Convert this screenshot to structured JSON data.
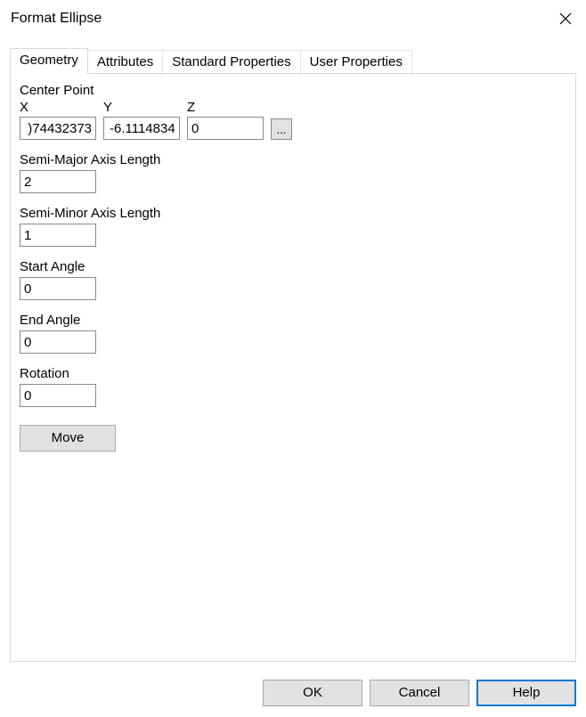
{
  "window": {
    "title": "Format Ellipse"
  },
  "tabs": {
    "geometry": "Geometry",
    "attributes": "Attributes",
    "standard_properties": "Standard Properties",
    "user_properties": "User Properties",
    "active": "geometry"
  },
  "geometry": {
    "center_point_label": "Center Point",
    "x_label": "X",
    "y_label": "Y",
    "z_label": "Z",
    "x_value": ")74432373",
    "y_value": "-6.1114834",
    "z_value": "0",
    "ellipsis_label": "...",
    "semi_major_label": "Semi-Major Axis Length",
    "semi_major_value": "2",
    "semi_minor_label": "Semi-Minor Axis Length",
    "semi_minor_value": "1",
    "start_angle_label": "Start Angle",
    "start_angle_value": "0",
    "end_angle_label": "End Angle",
    "end_angle_value": "0",
    "rotation_label": "Rotation",
    "rotation_value": "0",
    "move_label": "Move"
  },
  "buttons": {
    "ok": "OK",
    "cancel": "Cancel",
    "help": "Help"
  }
}
